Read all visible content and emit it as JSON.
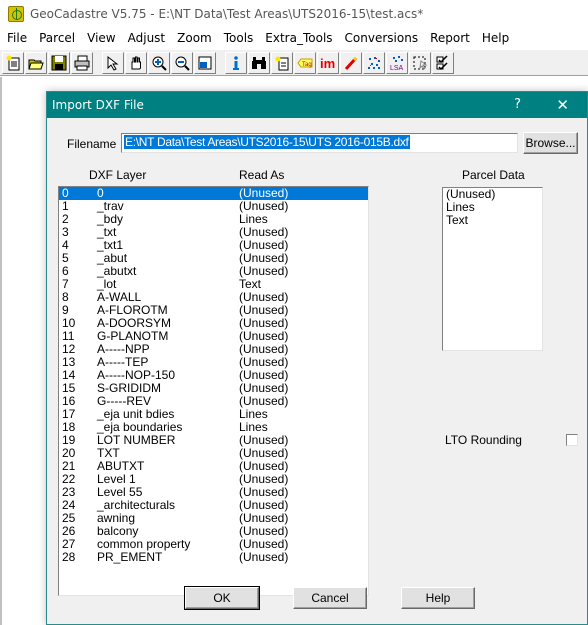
{
  "app": {
    "title": "GeoCadastre V5.75 - E:\\NT Data\\Test Areas\\UTS2016-15\\test.acs*",
    "icon": "geocadastre-app-icon"
  },
  "menu": [
    "File",
    "Parcel",
    "View",
    "Adjust",
    "Zoom",
    "Tools",
    "Extra_Tools",
    "Conversions",
    "Report",
    "Help"
  ],
  "toolbar": {
    "group1": [
      {
        "icon": "new-file-icon",
        "glyph": "✱"
      },
      {
        "icon": "open-folder-icon",
        "glyph": "📂"
      },
      {
        "icon": "save-icon",
        "glyph": "💾"
      },
      {
        "icon": "print-icon",
        "glyph": "🖶"
      }
    ],
    "group2": [
      {
        "icon": "select-arrow-icon",
        "glyph": "↖"
      },
      {
        "icon": "pan-hand-icon",
        "glyph": "✋"
      },
      {
        "icon": "zoom-in-icon",
        "glyph": "⊕"
      },
      {
        "icon": "zoom-out-icon",
        "glyph": "⊖"
      },
      {
        "icon": "zoom-window-icon",
        "glyph": "▣"
      }
    ],
    "group3": [
      {
        "icon": "info-icon",
        "glyph": "i"
      },
      {
        "icon": "find-binoculars-icon",
        "glyph": "⚲"
      },
      {
        "icon": "new-note-icon",
        "glyph": "✱"
      },
      {
        "icon": "tag-icon",
        "glyph": "Tag"
      },
      {
        "icon": "import-im-icon",
        "glyph": "im"
      },
      {
        "icon": "pencil-icon",
        "glyph": "✎"
      },
      {
        "icon": "points-icon",
        "glyph": "⁘"
      },
      {
        "icon": "lsa-adjust-icon",
        "glyph": "LSA"
      },
      {
        "icon": "select-region-icon",
        "glyph": "⬚"
      },
      {
        "icon": "checklist-icon",
        "glyph": "☑"
      }
    ]
  },
  "dialog": {
    "title": "Import DXF File",
    "help_glyph": "?",
    "close_glyph": "✕",
    "filename_label": "Filename",
    "filename_value": "E:\\NT Data\\Test Areas\\UTS2016-15\\UTS 2016-015B.dxf",
    "browse_label": "Browse...",
    "col_layer": "DXF Layer",
    "col_read_as": "Read As",
    "parcel_data_label": "Parcel Data",
    "parcel_options": [
      "(Unused)",
      "Lines",
      "Text"
    ],
    "lto_rounding_label": "LTO Rounding",
    "lto_rounding_checked": false,
    "ok_label": "OK",
    "cancel_label": "Cancel",
    "help_label": "Help",
    "selected_index": 0,
    "layers": [
      {
        "idx": "0",
        "name": "0",
        "read_as": "(Unused)"
      },
      {
        "idx": "1",
        "name": "_trav",
        "read_as": "(Unused)"
      },
      {
        "idx": "2",
        "name": "_bdy",
        "read_as": "Lines"
      },
      {
        "idx": "3",
        "name": "_txt",
        "read_as": "(Unused)"
      },
      {
        "idx": "4",
        "name": "_txt1",
        "read_as": "(Unused)"
      },
      {
        "idx": "5",
        "name": "_abut",
        "read_as": "(Unused)"
      },
      {
        "idx": "6",
        "name": "_abutxt",
        "read_as": "(Unused)"
      },
      {
        "idx": "7",
        "name": "_lot",
        "read_as": "Text"
      },
      {
        "idx": "8",
        "name": "A-WALL",
        "read_as": "(Unused)"
      },
      {
        "idx": "9",
        "name": "A-FLOROTM",
        "read_as": "(Unused)"
      },
      {
        "idx": "10",
        "name": "A-DOORSYM",
        "read_as": "(Unused)"
      },
      {
        "idx": "11",
        "name": "G-PLANOTM",
        "read_as": "(Unused)"
      },
      {
        "idx": "12",
        "name": "A-----NPP",
        "read_as": "(Unused)"
      },
      {
        "idx": "13",
        "name": "A-----TEP",
        "read_as": "(Unused)"
      },
      {
        "idx": "14",
        "name": "A-----NOP-150",
        "read_as": "(Unused)"
      },
      {
        "idx": "15",
        "name": "S-GRIDIDM",
        "read_as": "(Unused)"
      },
      {
        "idx": "16",
        "name": "G-----REV",
        "read_as": "(Unused)"
      },
      {
        "idx": "17",
        "name": "_eja unit bdies",
        "read_as": "Lines"
      },
      {
        "idx": "18",
        "name": "_eja boundaries",
        "read_as": "Lines"
      },
      {
        "idx": "19",
        "name": "LOT NUMBER",
        "read_as": "(Unused)"
      },
      {
        "idx": "20",
        "name": "TXT",
        "read_as": "(Unused)"
      },
      {
        "idx": "21",
        "name": "ABUTXT",
        "read_as": "(Unused)"
      },
      {
        "idx": "22",
        "name": "Level 1",
        "read_as": "(Unused)"
      },
      {
        "idx": "23",
        "name": "Level 55",
        "read_as": "(Unused)"
      },
      {
        "idx": "24",
        "name": "_architecturals",
        "read_as": "(Unused)"
      },
      {
        "idx": "25",
        "name": "awning",
        "read_as": "(Unused)"
      },
      {
        "idx": "26",
        "name": "balcony",
        "read_as": "(Unused)"
      },
      {
        "idx": "27",
        "name": "common property",
        "read_as": "(Unused)"
      },
      {
        "idx": "28",
        "name": "PR_EMENT",
        "read_as": "(Unused)"
      }
    ]
  },
  "colors": {
    "dialog_title_bg": "#008080",
    "selection": "#0078d7"
  }
}
